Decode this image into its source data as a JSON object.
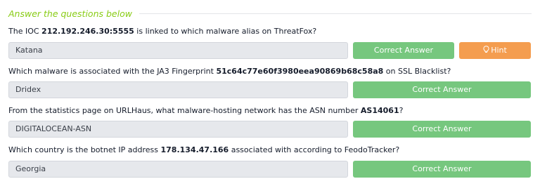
{
  "section": {
    "title": "Answer the questions below"
  },
  "questions": [
    {
      "prefix": "The IOC ",
      "highlight": "212.192.246.30:5555",
      "suffix": " is linked to which malware alias on ThreatFox?",
      "answer": "Katana",
      "button": "Correct Answer",
      "hint": "Hint"
    },
    {
      "prefix": "Which malware is associated with the JA3 Fingerprint ",
      "highlight": "51c64c77e60f3980eea90869b68c58a8",
      "suffix": " on SSL Blacklist?",
      "answer": "Dridex",
      "button": "Correct Answer"
    },
    {
      "prefix": "From the statistics page on URLHaus, what malware-hosting network has the ASN number ",
      "highlight": "AS14061",
      "suffix": "?",
      "answer": "DIGITALOCEAN-ASN",
      "button": "Correct Answer"
    },
    {
      "prefix": "Which country is the botnet IP address ",
      "highlight": "178.134.47.166",
      "suffix": " associated with according to FeodoTracker?",
      "answer": "Georgia",
      "button": "Correct Answer"
    }
  ],
  "colors": {
    "accent_title": "#88cc14",
    "correct_button": "#76c77e",
    "hint_button": "#f49d4f"
  },
  "icons": {
    "hint": "lightbulb-icon"
  }
}
